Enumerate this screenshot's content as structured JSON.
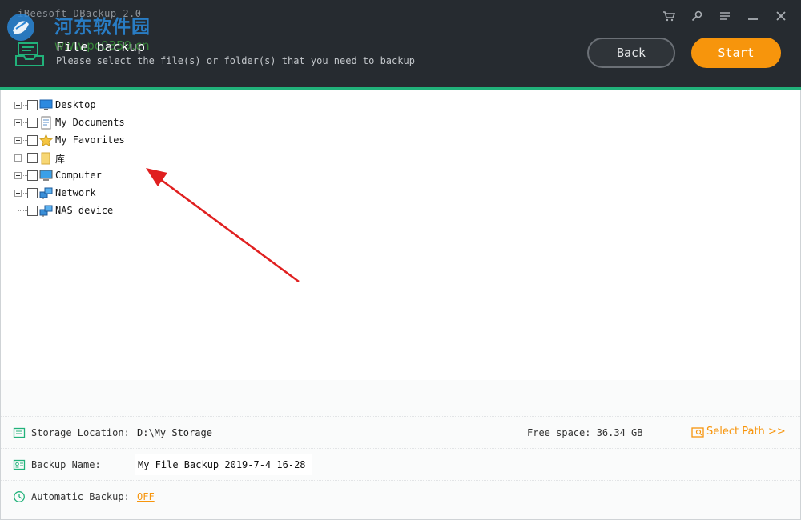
{
  "app": {
    "title": "iBeesoft DBackup 2.0",
    "watermark_text": "河东软件园",
    "watermark_url": "www.pc0359.cn"
  },
  "header": {
    "page_title": "File backup",
    "subtitle": "Please select the file(s) or folder(s) that you need to backup",
    "back_label": "Back",
    "start_label": "Start",
    "accent_color": "#21b27a",
    "start_color": "#f7950c",
    "controls": [
      "cart-icon",
      "key-icon",
      "menu-icon",
      "minimize-icon",
      "close-icon"
    ]
  },
  "tree": {
    "items": [
      {
        "label": "Desktop",
        "icon": "desktop-icon",
        "expandable": true,
        "checked": false
      },
      {
        "label": "My Documents",
        "icon": "document-icon",
        "expandable": true,
        "checked": false
      },
      {
        "label": "My Favorites",
        "icon": "star-icon",
        "expandable": true,
        "checked": false
      },
      {
        "label": "库",
        "icon": "folder-icon",
        "expandable": true,
        "checked": false
      },
      {
        "label": "Computer",
        "icon": "computer-icon",
        "expandable": true,
        "checked": false
      },
      {
        "label": "Network",
        "icon": "network-icon",
        "expandable": true,
        "checked": false
      },
      {
        "label": "NAS device",
        "icon": "network-icon",
        "expandable": false,
        "checked": false
      }
    ]
  },
  "info": {
    "storage_label": "Storage Location:",
    "storage_value": "D:\\My Storage",
    "free_space": "Free space: 36.34 GB",
    "select_path": "Select Path >>",
    "backup_name_label": "Backup Name:",
    "backup_name_value": "My File Backup 2019-7-4 16-28",
    "auto_backup_label": "Automatic Backup:",
    "auto_backup_value": "OFF"
  }
}
